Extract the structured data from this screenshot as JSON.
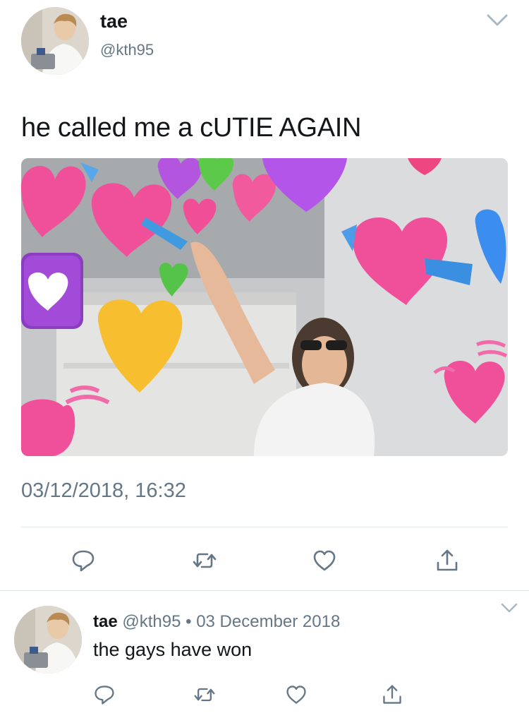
{
  "tweet": {
    "author": {
      "name": "tae",
      "handle": "@kth95",
      "avatar": "avatar-photo"
    },
    "text": "he called me a cUTIE AGAIN",
    "timestamp": "03/12/2018, 16:32",
    "media": {
      "description_icon": "photo-girl-with-heart-emojis"
    },
    "actions": {
      "reply": "reply-icon",
      "retweet": "retweet-icon",
      "like": "like-icon",
      "share": "share-icon"
    },
    "menu_icon": "chevron-down-icon"
  },
  "reply": {
    "author": {
      "name": "tae",
      "handle": "@kth95"
    },
    "separator": "•",
    "date": "03 December 2018",
    "text": "the gays have won",
    "actions": {
      "reply": "reply-icon",
      "retweet": "retweet-icon",
      "like": "like-icon",
      "share": "share-icon"
    },
    "menu_icon": "chevron-down-icon"
  },
  "colors": {
    "text_primary": "#14171a",
    "text_secondary": "#657786",
    "divider": "#e1e8ed",
    "icon": "#657786"
  }
}
